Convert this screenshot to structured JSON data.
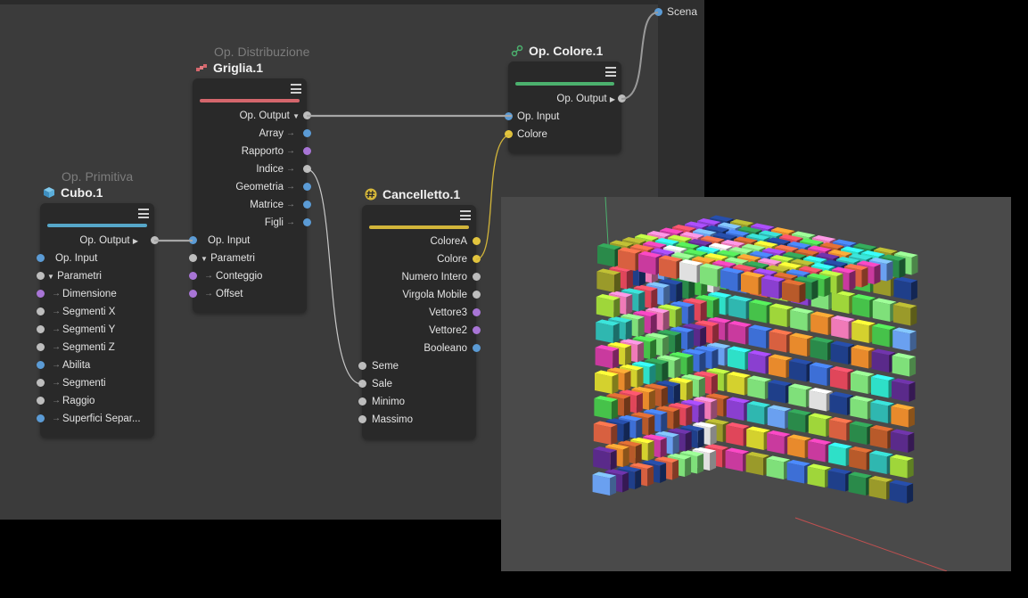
{
  "scene": {
    "label": "Scena"
  },
  "nodes": {
    "cubo": {
      "subtitle": "Op. Primitiva",
      "title": "Cubo.1",
      "output": "Op. Output",
      "input": "Op. Input",
      "group": "Parametri",
      "params": [
        "Dimensione",
        "Segmenti X",
        "Segmenti Y",
        "Segmenti Z",
        "Abilita",
        "Segmenti",
        "Raggio",
        "Superfici Separ..."
      ]
    },
    "griglia": {
      "subtitle": "Op. Distribuzione",
      "title": "Griglia.1",
      "output": "Op. Output",
      "outputs": [
        "Array",
        "Rapporto",
        "Indice",
        "Geometria",
        "Matrice",
        "Figli"
      ],
      "input": "Op. Input",
      "group": "Parametri",
      "params": [
        "Conteggio",
        "Offset"
      ]
    },
    "cancelletto": {
      "title": "Cancelletto.1",
      "outputs": [
        "ColoreA",
        "Colore",
        "Numero Intero",
        "Virgola Mobile",
        "Vettore3",
        "Vettore2",
        "Booleano"
      ],
      "inputs": [
        "Seme",
        "Sale",
        "Minimo",
        "Massimo"
      ]
    },
    "colore": {
      "title": "Op. Colore.1",
      "output": "Op. Output",
      "inputs": [
        "Op. Input",
        "Colore"
      ]
    }
  },
  "colors": {
    "port_blue": "#5b9bd5",
    "port_purple": "#a875d6",
    "port_grey": "#bdbdbd",
    "port_yellow": "#e2c43e",
    "cubo_bar": "#56a7c9",
    "griglia_bar": "#d4666c",
    "cancelletto_bar": "#d2b53a",
    "colore_bar": "#4cb16e"
  },
  "icons": {
    "cubo": "cube-icon",
    "griglia": "grid-distribution-icon",
    "cancelletto": "hash-icon",
    "colore": "color-op-icon",
    "menu": "hamburger-menu-icon"
  },
  "viewport": {
    "grid_count": 10
  }
}
